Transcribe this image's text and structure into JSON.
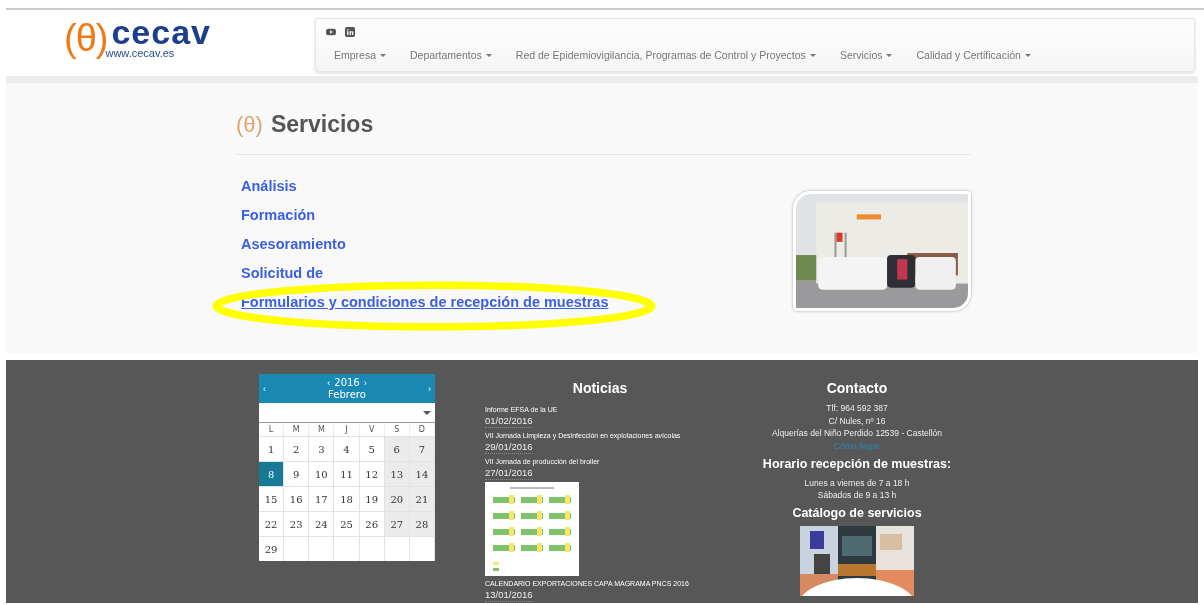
{
  "header": {
    "logo": {
      "symbol": "(θ)",
      "name": "cecav",
      "url": "www.cecav.es"
    },
    "nav": {
      "items": [
        {
          "label": "Empresa",
          "dropdown": true
        },
        {
          "label": "Departamentos",
          "dropdown": true
        },
        {
          "label": "Red de Epidemiovigilancia, Programas de Control y Proyectos",
          "dropdown": true
        },
        {
          "label": "Servicios",
          "dropdown": true
        },
        {
          "label": "Calidad y Certificación",
          "dropdown": true
        }
      ]
    }
  },
  "main": {
    "heading": {
      "symbol": "(θ)",
      "title": "Servicios"
    },
    "links": [
      {
        "label": "Análisis",
        "highlighted": false
      },
      {
        "label": "Formación",
        "highlighted": false
      },
      {
        "label": "Asesoramiento",
        "highlighted": false
      },
      {
        "label": "Solicitud de",
        "highlighted": false
      },
      {
        "label": "Formularios y condiciones de recepción de muestras",
        "highlighted": true
      }
    ],
    "photo": {
      "kind": "picture"
    }
  },
  "footer": {
    "calendar": {
      "year": "2016",
      "prev_year": "‹",
      "next_year": "›",
      "prev_month": "‹",
      "next_month": "›",
      "month": "Febrero",
      "weekdays": [
        "L",
        "M",
        "M",
        "J",
        "V",
        "S",
        "D"
      ],
      "days": [
        {
          "day": "1",
          "selected": false
        },
        {
          "day": "2",
          "selected": false
        },
        {
          "day": "3",
          "selected": false
        },
        {
          "day": "4",
          "selected": false
        },
        {
          "day": "5",
          "selected": false
        },
        {
          "day": "6",
          "selected": false
        },
        {
          "day": "7",
          "selected": false
        },
        {
          "day": "8",
          "selected": true
        },
        {
          "day": "9",
          "selected": false
        },
        {
          "day": "10",
          "selected": false
        },
        {
          "day": "11",
          "selected": false
        },
        {
          "day": "12",
          "selected": false
        },
        {
          "day": "13",
          "selected": false
        },
        {
          "day": "14",
          "selected": false
        },
        {
          "day": "15",
          "selected": false
        },
        {
          "day": "16",
          "selected": false
        },
        {
          "day": "17",
          "selected": false
        },
        {
          "day": "18",
          "selected": false
        },
        {
          "day": "19",
          "selected": false
        },
        {
          "day": "20",
          "selected": false
        },
        {
          "day": "21",
          "selected": false
        },
        {
          "day": "22",
          "selected": false
        },
        {
          "day": "23",
          "selected": false
        },
        {
          "day": "24",
          "selected": false
        },
        {
          "day": "25",
          "selected": false
        },
        {
          "day": "26",
          "selected": false
        },
        {
          "day": "27",
          "selected": false
        },
        {
          "day": "28",
          "selected": false
        },
        {
          "day": "29",
          "selected": false
        }
      ]
    },
    "news": {
      "title": "Noticias",
      "items": [
        {
          "title": "Informe EFSA de la UE",
          "date": "01/02/2016",
          "thumbnail": false
        },
        {
          "title": "VII Jornada Limpieza y Desinfección en explotaciones avícolas",
          "date": "29/01/2016",
          "thumbnail": false
        },
        {
          "title": "VII Jornada de producción del broiler",
          "date": "27/01/2016",
          "thumbnail": false
        },
        {
          "title": "CALENDARIO EXPORTACIONES CAPA MAGRAMA PNCS 2016",
          "date": "13/01/2016",
          "thumbnail": true
        }
      ]
    },
    "contact": {
      "title": "Contacto",
      "lines": [
        "Tlf: 964 592 387",
        "C/ Nules, nº 16",
        "Alquerías del Niño Perdido 12539 - Castellón"
      ],
      "link": "Cómo llegar",
      "hours_title": "Horario recepción de muestras:",
      "hours": [
        "Lunes a viernes de 7 a 18 h",
        "Sábados de 9 a 13 h"
      ],
      "catalog_title": "Catálogo de servicios",
      "catalog_image": {
        "kind": "picture"
      }
    }
  }
}
